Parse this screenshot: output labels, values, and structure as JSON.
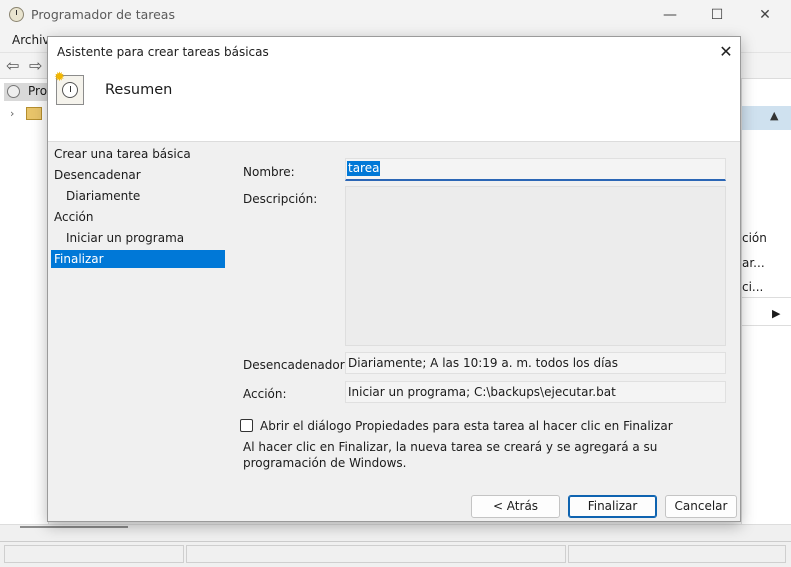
{
  "main_window": {
    "title": "Programador de tareas",
    "menu_first": "Archivo",
    "tree_root": "Pro",
    "action_items": [
      "ción",
      "ar...",
      "ci..."
    ]
  },
  "dialog": {
    "title": "Asistente para crear tareas básicas",
    "heading": "Resumen",
    "steps": [
      {
        "label": "Crear una tarea básica"
      },
      {
        "label": "Desencadenar"
      },
      {
        "label": "Diariamente"
      },
      {
        "label": "Acción"
      },
      {
        "label": "Iniciar un programa"
      },
      {
        "label": "Finalizar"
      }
    ],
    "name_label": "Nombre:",
    "name_value": "tarea",
    "description_label": "Descripción:",
    "description_value": "",
    "trigger_label": "Desencadenador:",
    "trigger_value": "Diariamente; A las 10:19 a. m. todos los días",
    "action_label": "Acción:",
    "action_value": "Iniciar un programa; C:\\backups\\ejecutar.bat",
    "checkbox_label": "Abrir el diálogo Propiedades para esta tarea al hacer clic en Finalizar",
    "checkbox_checked": false,
    "note": "Al hacer clic en Finalizar, la nueva tarea se creará y se agregará a su programación de Windows.",
    "buttons": {
      "back": "< Atrás",
      "finish": "Finalizar",
      "cancel": "Cancelar"
    }
  }
}
